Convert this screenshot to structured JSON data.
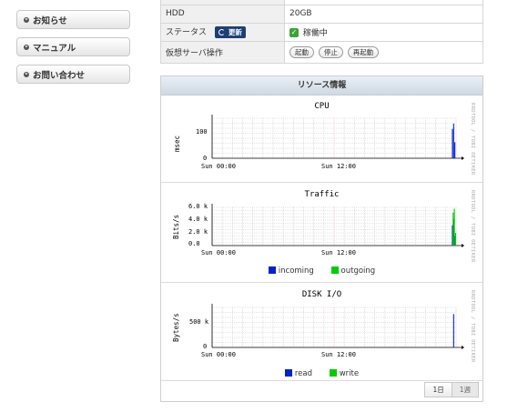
{
  "sidebar": {
    "items": [
      {
        "label": "お知らせ"
      },
      {
        "label": "マニュアル"
      },
      {
        "label": "お問い合わせ"
      }
    ]
  },
  "info": {
    "hdd_label": "HDD",
    "hdd_value": "20GB",
    "status_label": "ステータス",
    "update_label": "更新",
    "status_value": "稼働中",
    "ops_label": "仮想サーバ操作",
    "ops": [
      "起動",
      "停止",
      "再起動"
    ]
  },
  "panel": {
    "title": "リソース情報",
    "watermark": "RRDTOOL / TOBI OETIKER",
    "periods": [
      "1日",
      "1週"
    ]
  },
  "chart_data": [
    {
      "type": "line",
      "title": "CPU",
      "ylabel": "msec",
      "xticks": [
        "Sun 00:00",
        "Sun 12:00"
      ],
      "yticks": [
        "100",
        "0"
      ],
      "ylim": [
        0,
        150
      ],
      "series": [
        {
          "color": "#0022cc",
          "x": [
            0.985,
            0.99,
            0.995
          ],
          "values": [
            110,
            130,
            60
          ]
        }
      ]
    },
    {
      "type": "line",
      "title": "Traffic",
      "ylabel": "Bits/s",
      "xticks": [
        "Sun 00:00",
        "Sun 12:00"
      ],
      "yticks": [
        "6.0 k",
        "4.0 k",
        "2.0 k",
        "0.0"
      ],
      "ylim": [
        0,
        6000
      ],
      "series": [
        {
          "name": "incoming",
          "color": "#0022cc",
          "x": [
            0.985,
            0.99,
            0.995
          ],
          "values": [
            3200,
            4200,
            1500
          ]
        },
        {
          "name": "outgoing",
          "color": "#00cc00",
          "x": [
            0.985,
            0.99,
            0.995
          ],
          "values": [
            5200,
            5800,
            2000
          ]
        }
      ]
    },
    {
      "type": "line",
      "title": "DISK I/O",
      "ylabel": "Bytes/s",
      "xticks": [
        "Sun 00:00",
        "Sun 12:00"
      ],
      "yticks": [
        "500 k",
        "0"
      ],
      "ylim": [
        0,
        900000
      ],
      "series": [
        {
          "name": "read",
          "color": "#0022cc",
          "x": [
            0.99
          ],
          "values": [
            750000
          ]
        },
        {
          "name": "write",
          "color": "#00cc00",
          "x": [
            0.99
          ],
          "values": [
            0
          ]
        }
      ]
    }
  ]
}
